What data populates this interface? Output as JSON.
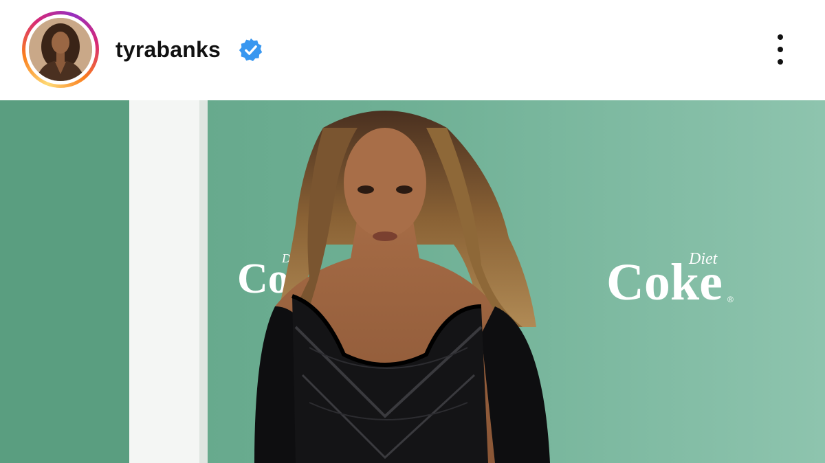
{
  "post": {
    "username": "tyrabanks",
    "verified": true,
    "colors": {
      "story_ring": [
        "#feda75",
        "#fa7e1e",
        "#d62976",
        "#962fbf"
      ],
      "verified_badge": "#3897f0",
      "backdrop": "#6fb095"
    },
    "icons": {
      "verified": "verified-badge-icon",
      "more": "more-vertical-icon"
    },
    "photo": {
      "backdrop_logo_left": "Co",
      "backdrop_logo_left_small": "Diet",
      "backdrop_logo_right": "Coke",
      "backdrop_logo_right_small": "Diet",
      "registered_mark": "®"
    }
  }
}
